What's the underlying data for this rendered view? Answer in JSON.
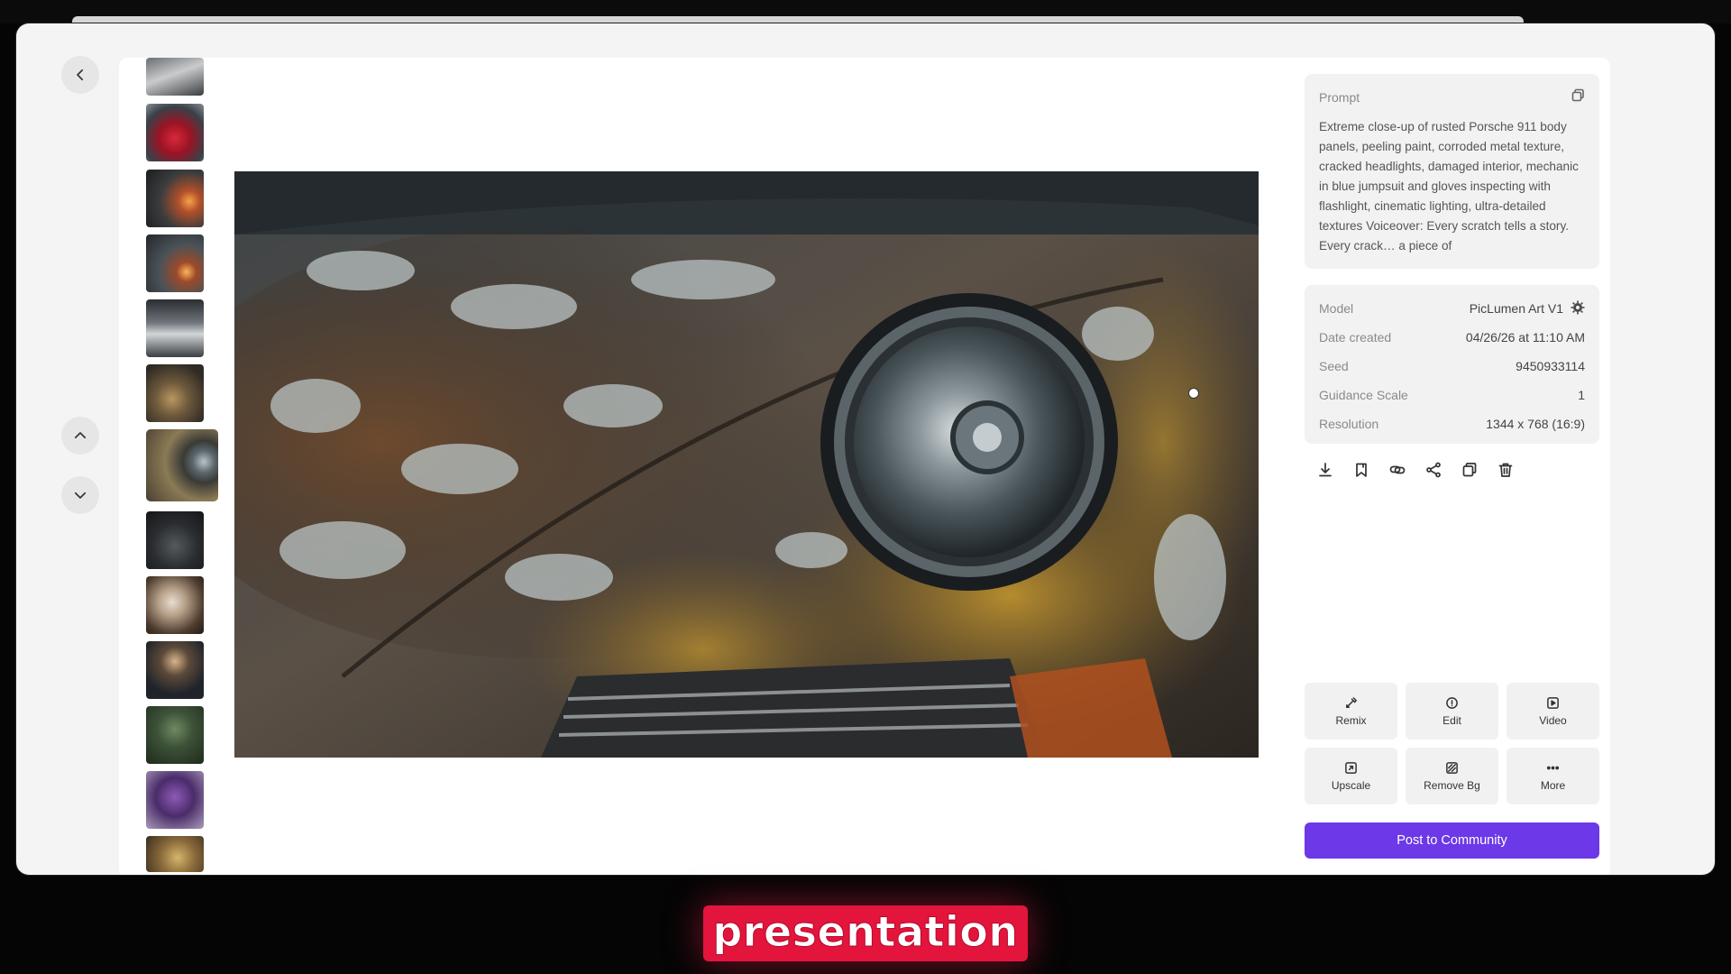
{
  "nav": {
    "back_icon": "chevron-left-icon",
    "prev_icon": "chevron-up-icon",
    "next_icon": "chevron-down-icon"
  },
  "thumbnails": [
    {
      "subject": "wrecked silver car"
    },
    {
      "subject": "red sports car"
    },
    {
      "subject": "car with sparks"
    },
    {
      "subject": "car bodywork with sparks"
    },
    {
      "subject": "white car in workshop"
    },
    {
      "subject": "rusted car closeup"
    },
    {
      "subject": "rusted Porsche headlight",
      "active": true
    },
    {
      "subject": "dark car in garage"
    },
    {
      "subject": "wedding couple"
    },
    {
      "subject": "man in suit with plant"
    },
    {
      "subject": "green statue"
    },
    {
      "subject": "purple robed figure"
    },
    {
      "subject": "golden statue"
    }
  ],
  "prompt": {
    "label": "Prompt",
    "text": "Extreme close-up of rusted Porsche 911 body panels, peeling paint, corroded metal texture, cracked headlights, damaged interior, mechanic in blue jumpsuit and gloves inspecting with flashlight, cinematic lighting, ultra-detailed textures Voiceover: Every scratch tells a story. Every crack… a piece of",
    "copy_icon": "copy-icon"
  },
  "meta": {
    "model_label": "Model",
    "model_value": "PicLumen Art V1",
    "date_label": "Date created",
    "date_value": "04/26/26 at 11:10 AM",
    "seed_label": "Seed",
    "seed_value": "9450933114",
    "guidance_label": "Guidance Scale",
    "guidance_value": "1",
    "resolution_label": "Resolution",
    "resolution_value": "1344 x 768 (16:9)"
  },
  "toolbar": [
    "download-icon",
    "bookmark-icon",
    "link-icon",
    "share-icon",
    "duplicate-icon",
    "trash-icon"
  ],
  "actions": {
    "remix": "Remix",
    "edit": "Edit",
    "video": "Video",
    "upscale": "Upscale",
    "remove_bg": "Remove Bg",
    "more": "More"
  },
  "post_button": "Post to Community",
  "caption": "presentation",
  "colors": {
    "accent": "#6c38e8",
    "caption_bg": "#e3153c"
  }
}
